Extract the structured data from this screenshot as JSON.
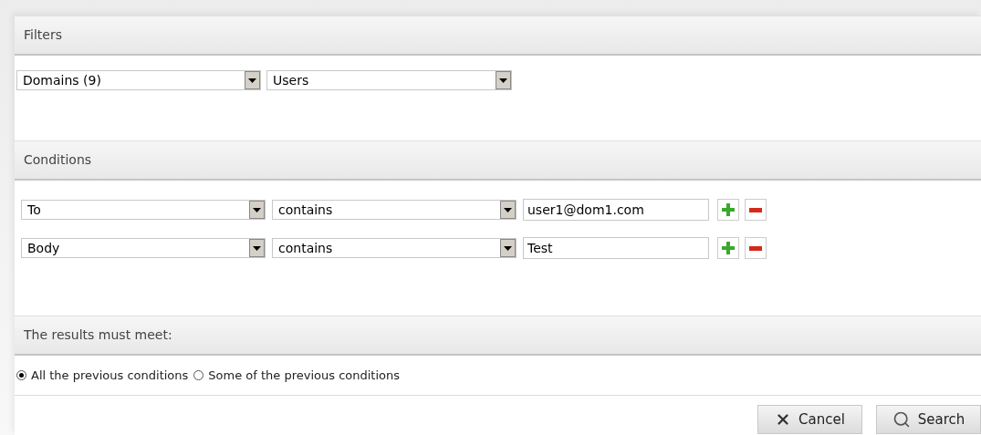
{
  "filters": {
    "title": "Filters",
    "selects": [
      {
        "value": "Domains (9)"
      },
      {
        "value": "Users"
      }
    ]
  },
  "conditions": {
    "title": "Conditions",
    "rows": [
      {
        "field": "To",
        "operator": "contains",
        "value": "user1@dom1.com"
      },
      {
        "field": "Body",
        "operator": "contains",
        "value": "Test"
      }
    ]
  },
  "match": {
    "title": "The results must meet:",
    "options": [
      {
        "label": "All the previous conditions",
        "selected": true
      },
      {
        "label": "Some of the previous conditions",
        "selected": false
      }
    ]
  },
  "buttons": [
    {
      "kind": "cancel",
      "label": "Cancel"
    },
    {
      "kind": "search",
      "label": "Search"
    }
  ]
}
